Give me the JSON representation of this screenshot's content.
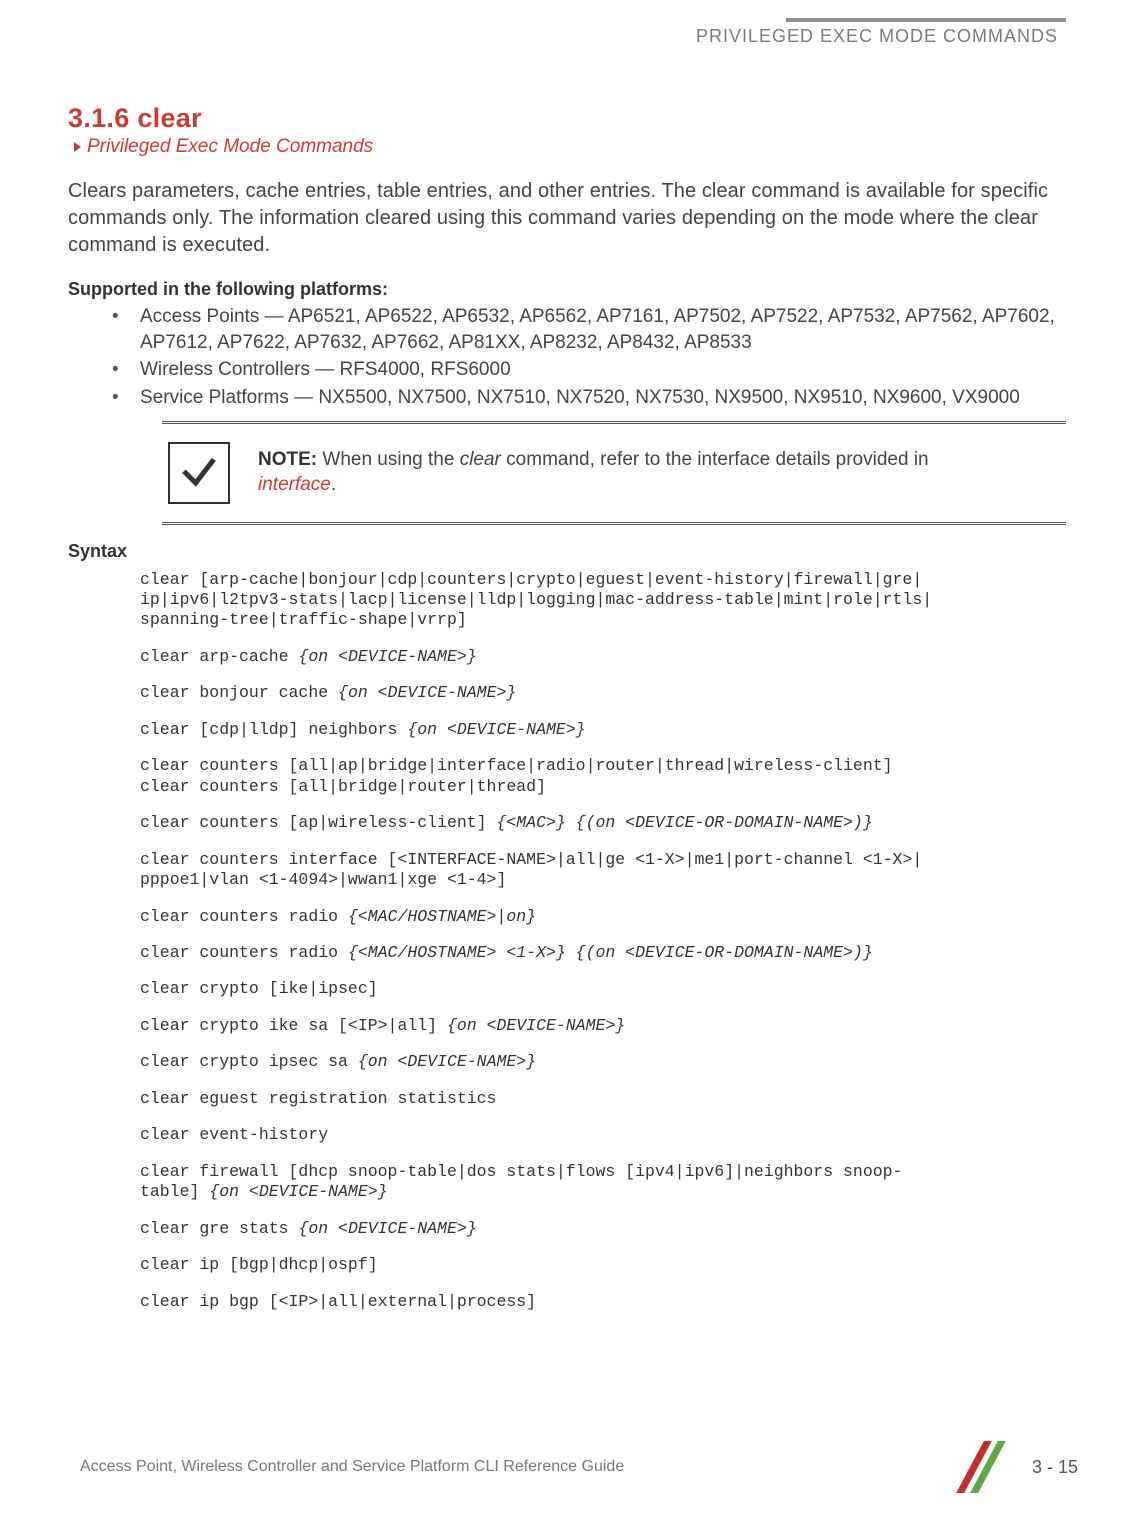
{
  "header": {
    "running": "PRIVILEGED EXEC MODE COMMANDS"
  },
  "section": {
    "number_title": "3.1.6 clear",
    "breadcrumb": "Privileged Exec Mode Commands",
    "intro": "Clears parameters, cache entries, table entries, and other entries. The clear command is available for specific commands only. The information cleared using this command varies depending on the mode where the clear command is executed."
  },
  "supported": {
    "heading": "Supported in the following platforms:",
    "items": [
      "Access Points — AP6521, AP6522, AP6532, AP6562, AP7161, AP7502, AP7522, AP7532, AP7562, AP7602, AP7612, AP7622, AP7632, AP7662, AP81XX, AP8232, AP8432, AP8533",
      "Wireless Controllers — RFS4000, RFS6000",
      "Service Platforms — NX5500, NX7500, NX7510, NX7520, NX7530, NX9500, NX9510, NX9600, VX9000"
    ]
  },
  "note": {
    "label": "NOTE:",
    "prefix": " When using the ",
    "cmd": "clear",
    "mid": " command, refer to the interface details provided in ",
    "link": "interface",
    "suffix": "."
  },
  "syntax": {
    "heading": "Syntax",
    "lines": [
      {
        "plain": "clear [arp-cache|bonjour|cdp|counters|crypto|eguest|event-history|firewall|gre|\nip|ipv6|l2tpv3-stats|lacp|license|lldp|logging|mac-address-table|mint|role|rtls|\nspanning-tree|traffic-shape|vrrp]"
      },
      {
        "plain": "clear arp-cache ",
        "ital": "{on <DEVICE-NAME>}"
      },
      {
        "plain": "clear bonjour cache ",
        "ital": "{on <DEVICE-NAME>}"
      },
      {
        "plain": "clear [cdp|lldp] neighbors ",
        "ital": "{on <DEVICE-NAME>}"
      },
      {
        "plain": "clear counters [all|ap|bridge|interface|radio|router|thread|wireless-client]\nclear counters [all|bridge|router|thread]"
      },
      {
        "plain": "clear counters [ap|wireless-client] ",
        "ital": "{<MAC>} {(on <DEVICE-OR-DOMAIN-NAME>)}"
      },
      {
        "plain": "clear counters interface [<INTERFACE-NAME>|all|ge <1-X>|me1|port-channel <1-X>|\npppoe1|vlan <1-4094>|wwan1|xge <1-4>]"
      },
      {
        "plain": "clear counters radio ",
        "ital": "{<MAC/HOSTNAME>|on}"
      },
      {
        "plain": "clear counters radio ",
        "ital": "{<MAC/HOSTNAME> <1-X>} {(on <DEVICE-OR-DOMAIN-NAME>)}"
      },
      {
        "plain": "clear crypto [ike|ipsec]"
      },
      {
        "plain": "clear crypto ike sa [<IP>|all] ",
        "ital": "{on <DEVICE-NAME>}"
      },
      {
        "plain": "clear crypto ipsec sa ",
        "ital": "{on <DEVICE-NAME>}"
      },
      {
        "plain": "clear eguest registration statistics"
      },
      {
        "plain": "clear event-history"
      },
      {
        "plain": "clear firewall [dhcp snoop-table|dos stats|flows [ipv4|ipv6]|neighbors snoop-\ntable] ",
        "ital": "{on <DEVICE-NAME>}"
      },
      {
        "plain": "clear gre stats ",
        "ital": "{on <DEVICE-NAME>}"
      },
      {
        "plain": "clear ip [bgp|dhcp|ospf]"
      },
      {
        "plain": "clear ip bgp [<IP>|all|external|process]"
      }
    ]
  },
  "footer": {
    "guide": "Access Point, Wireless Controller and Service Platform CLI Reference Guide",
    "page": "3 - 15"
  }
}
